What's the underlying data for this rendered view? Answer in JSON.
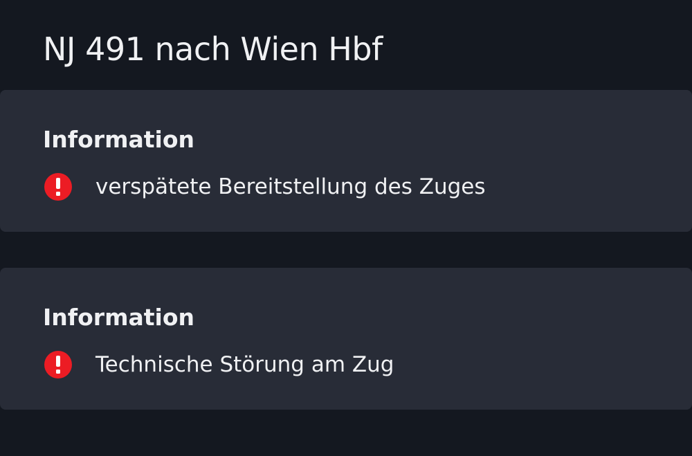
{
  "header": {
    "title": "NJ 491 nach Wien Hbf"
  },
  "messages": [
    {
      "heading": "Information",
      "icon": "alert-icon",
      "text": "verspätete Bereitstellung des Zuges"
    },
    {
      "heading": "Information",
      "icon": "alert-icon",
      "text": "Technische Störung am Zug"
    }
  ],
  "colors": {
    "background": "#141820",
    "card": "#282c37",
    "text": "#f0f1f3",
    "alert": "#ec1c24"
  }
}
